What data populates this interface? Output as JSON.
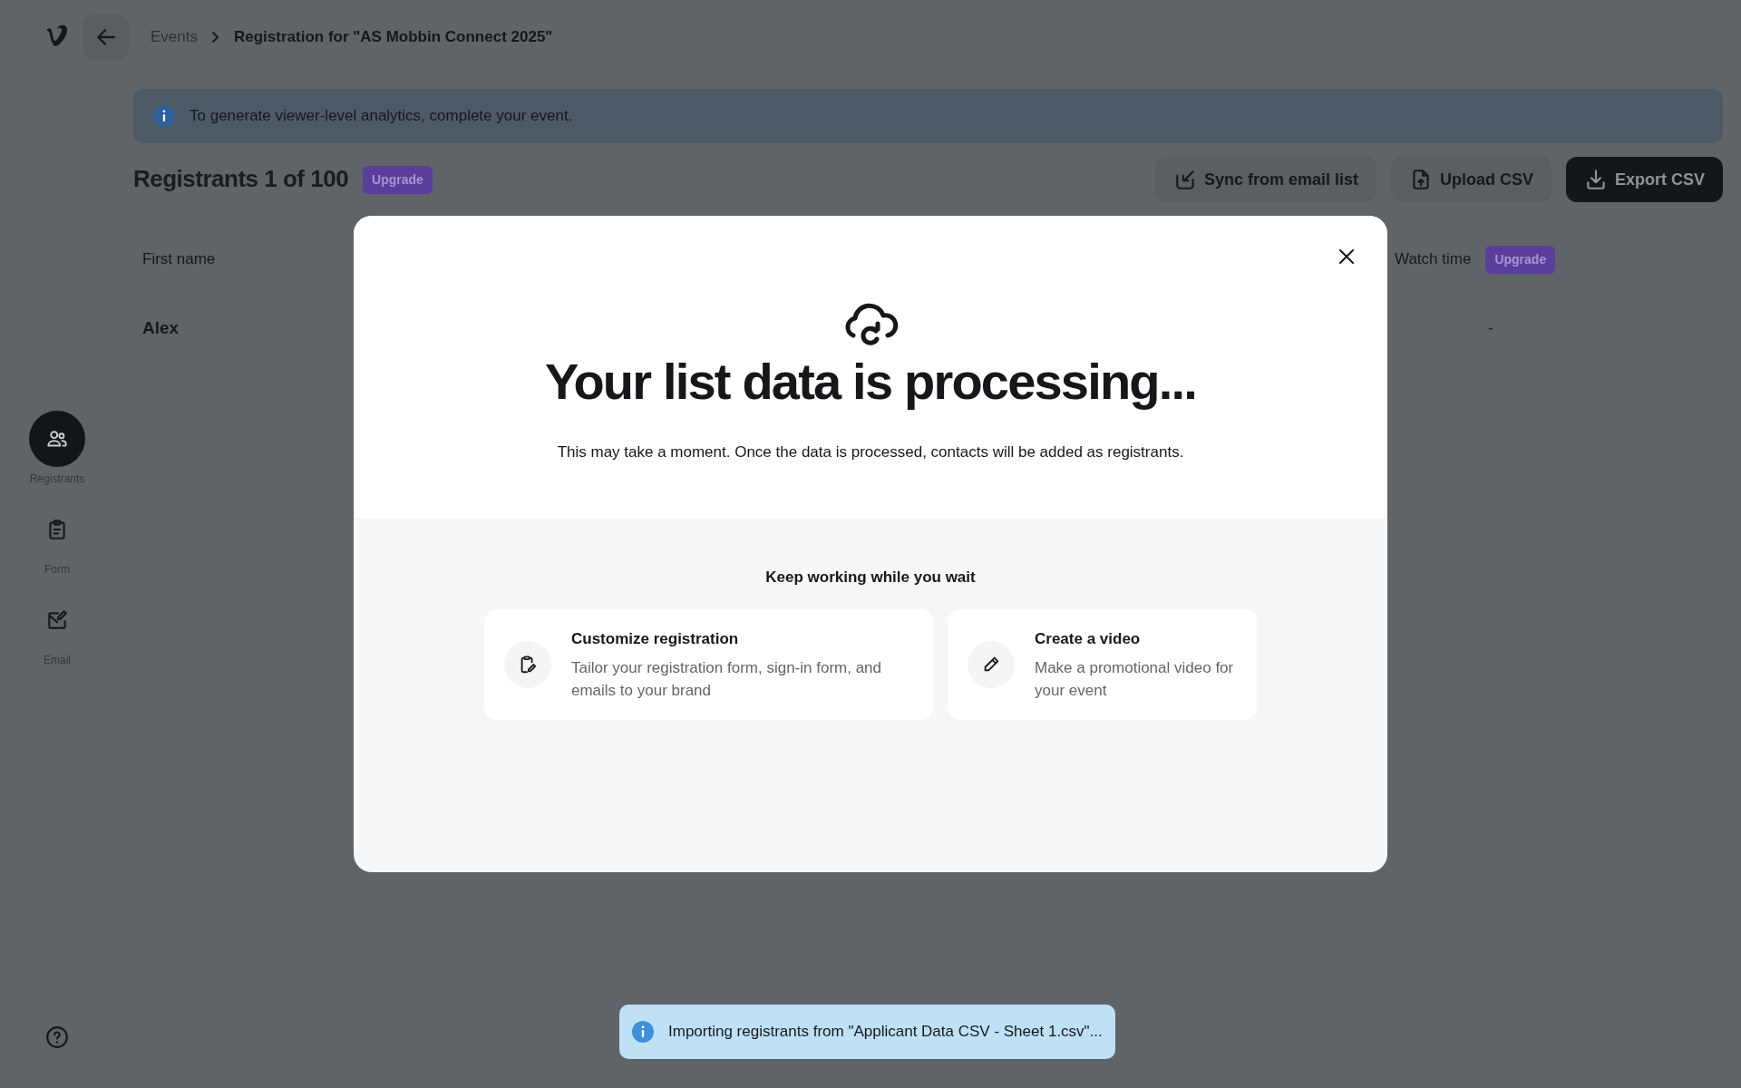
{
  "breadcrumb": [
    {
      "label": "Events"
    },
    {
      "label": "Registration for \"AS Mobbin Connect 2025\""
    }
  ],
  "banner": {
    "text": "To generate viewer-level analytics, complete your event."
  },
  "header": {
    "title": "Registrants 1 of 100",
    "badge": "Upgrade",
    "actions": [
      {
        "kind": "sync",
        "label": "Sync from email list",
        "primary": false
      },
      {
        "kind": "upload",
        "label": "Upload CSV",
        "primary": false
      },
      {
        "kind": "export",
        "label": "Export CSV",
        "primary": true
      }
    ]
  },
  "table": {
    "columns": [
      {
        "label": "First name"
      },
      {
        "label": "Watch time",
        "badge": "Upgrade"
      }
    ],
    "rows": [
      [
        "Alex",
        "-"
      ]
    ]
  },
  "sidebar": {
    "items": [
      {
        "kind": "registrants",
        "label": "Registrants",
        "selected": true
      },
      {
        "kind": "form",
        "label": "Form",
        "selected": false
      },
      {
        "kind": "email",
        "label": "Email",
        "selected": false
      }
    ]
  },
  "modal": {
    "title": "Your list data is processing...",
    "subtitle": "This may take a moment. Once the data is processed, contacts will be added as registrants.",
    "section_title": "Keep working while you wait",
    "cards": [
      {
        "kind": "registration",
        "title": "Customize registration",
        "description": "Tailor your registration form, sign-in form, and emails to your brand"
      },
      {
        "kind": "video",
        "title": "Create a video",
        "description": "Make a promotional video for your event"
      }
    ]
  },
  "toast": {
    "text": "Importing registrants from \"Applicant Data CSV - Sheet 1.csv\"..."
  }
}
